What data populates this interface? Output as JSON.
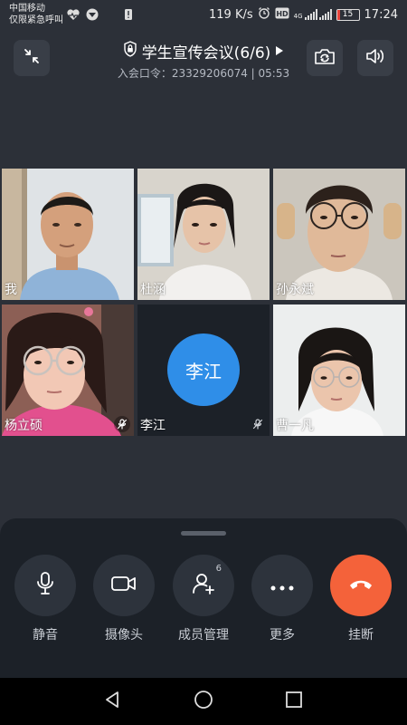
{
  "status_bar": {
    "carrier_line1": "中国移动",
    "carrier_line2": "仅限紧急呼叫",
    "net_speed": "119 K/s",
    "network_type": "4G",
    "battery_level": "15",
    "time": "17:24",
    "icons": [
      "heart-rate-icon",
      "vpn-icon",
      "alert-icon",
      "alarm-icon",
      "hd-icon",
      "signal-icon",
      "battery-icon"
    ]
  },
  "header": {
    "title": "学生宣传会议(6/6)",
    "meeting_code_label": "入会口令：23329206074 | 05:53",
    "icons": [
      "collapse-icon",
      "lock-icon",
      "play-triangle-icon",
      "switch-camera-icon",
      "speaker-icon"
    ]
  },
  "participants": [
    {
      "name": "我",
      "muted": false
    },
    {
      "name": "杜涵",
      "muted": false
    },
    {
      "name": "孙永斌",
      "muted": false
    },
    {
      "name": "杨立硕",
      "muted": true
    },
    {
      "name": "李江",
      "muted": true,
      "avatar_text": "李江",
      "avatar_color": "#2f8ee8"
    },
    {
      "name": "曹一凡",
      "muted": false
    }
  ],
  "controls": [
    {
      "id": "mute",
      "label": "静音",
      "icon": "microphone-icon"
    },
    {
      "id": "camera",
      "label": "摄像头",
      "icon": "video-camera-icon"
    },
    {
      "id": "members",
      "label": "成员管理",
      "icon": "add-member-icon",
      "badge": "6"
    },
    {
      "id": "more",
      "label": "更多",
      "icon": "more-dots-icon"
    },
    {
      "id": "hangup",
      "label": "挂断",
      "icon": "hang-up-icon",
      "color": "#f4623a"
    }
  ],
  "nav": {
    "icons": [
      "back-triangle-icon",
      "home-circle-icon",
      "recents-square-icon"
    ]
  }
}
